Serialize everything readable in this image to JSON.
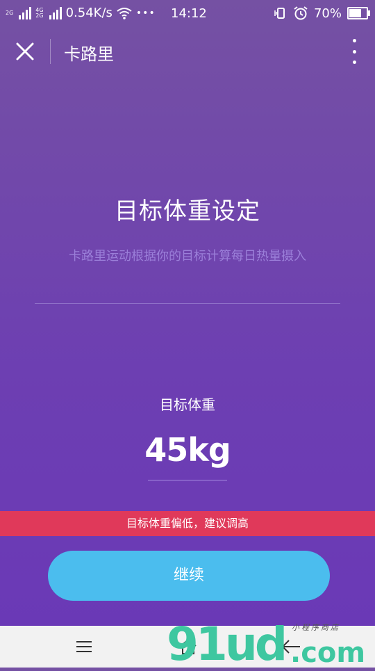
{
  "status_bar": {
    "net_small_1": "2G",
    "net_small_2a": "4G",
    "net_small_2b": "2G",
    "speed": "0.54K/s",
    "dots": "•••",
    "time": "14:12",
    "battery": "70%"
  },
  "title_bar": {
    "title": "卡路里"
  },
  "main": {
    "heading": "目标体重设定",
    "subtext": "卡路里运动根据你的目标计算每日热量摄入",
    "weight_label": "目标体重",
    "weight_value": "45kg",
    "warning": "目标体重偏低，建议调高",
    "continue_label": "继续"
  },
  "watermark": {
    "main": "91ud",
    "com": ".com",
    "small": "小程序商店"
  },
  "colors": {
    "background": "#6d3fb2",
    "warning": "#e0395a",
    "button": "#4bbdee"
  }
}
